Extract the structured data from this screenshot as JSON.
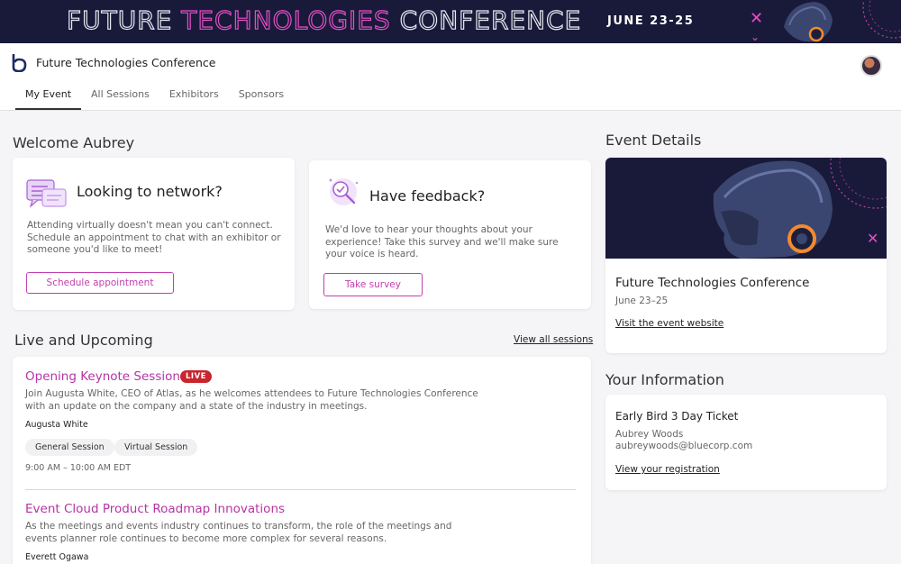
{
  "banner": {
    "title_part1": "FUTURE",
    "title_part2": "TECHNOLOGIES",
    "title_part3": "CONFERENCE",
    "date": "JUNE 23-25",
    "x_glyph": "✕",
    "chevron_glyph": "⌄"
  },
  "header": {
    "app_title": "Future Technologies Conference",
    "tabs": [
      {
        "label": "My Event",
        "active": true
      },
      {
        "label": "All Sessions",
        "active": false
      },
      {
        "label": "Exhibitors",
        "active": false
      },
      {
        "label": "Sponsors",
        "active": false
      }
    ]
  },
  "welcome": {
    "title": "Welcome Aubrey",
    "network_card": {
      "heading": "Looking to network?",
      "text": "Attending virtually doesn't mean you can't connect. Schedule an appointment to chat with an exhibitor or someone you'd like to meet!",
      "button": "Schedule appointment",
      "icon": "chat-bubbles-icon"
    },
    "feedback_card": {
      "heading": "Have feedback?",
      "text": "We'd love to hear your thoughts about your experience! Take this survey and we'll make sure your voice is heard.",
      "button": "Take survey",
      "icon": "magnifier-check-icon"
    }
  },
  "live": {
    "title": "Live and Upcoming",
    "view_all": "View all sessions",
    "sessions": [
      {
        "title": "Opening Keynote Session",
        "badge": "LIVE",
        "description": "Join Augusta White, CEO of Atlas, as he welcomes attendees to Future Technologies Conference with an update on the company and a state of the industry in meetings.",
        "speaker": "Augusta White",
        "tags": [
          "General Session",
          "Virtual Session"
        ],
        "time": "9:00 AM – 10:00 AM EDT"
      },
      {
        "title": "Event Cloud Product Roadmap Innovations",
        "description": "As the meetings and events industry continues to transform, the role of the meetings and events planner role continues to become more complex for several reasons.",
        "speaker": "Everett Ogawa"
      }
    ]
  },
  "event_details": {
    "title": "Event Details",
    "name": "Future Technologies Conference",
    "date": "June 23–25",
    "link": "Visit the event website"
  },
  "your_info": {
    "title": "Your Information",
    "ticket": "Early Bird 3 Day Ticket",
    "name": "Aubrey Woods",
    "email": "aubreywoods@bluecorp.com",
    "link": "View your registration"
  },
  "colors": {
    "accent": "#b634a4",
    "banner_bg": "#191a3a",
    "live_badge": "#c8252d"
  }
}
